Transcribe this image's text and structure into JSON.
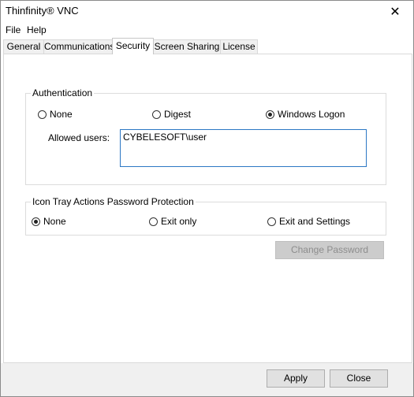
{
  "window": {
    "title": "Thinfinity® VNC",
    "close_glyph": "✕"
  },
  "menu": {
    "items": [
      "File",
      "Help"
    ]
  },
  "tabs": [
    "General",
    "Communications",
    "Security",
    "Screen Sharing",
    "License"
  ],
  "active_tab": "Security",
  "authentication": {
    "title": "Authentication",
    "options": [
      "None",
      "Digest",
      "Windows Logon"
    ],
    "selected": "Windows Logon",
    "allowed_users_label": "Allowed users:",
    "allowed_users_value": "CYBELESOFT\\user"
  },
  "icon_tray": {
    "title": "Icon Tray Actions Password Protection",
    "options": [
      "None",
      "Exit only",
      "Exit and Settings"
    ],
    "selected": "None"
  },
  "buttons": {
    "change_password": "Change Password",
    "apply": "Apply",
    "close": "Close"
  }
}
